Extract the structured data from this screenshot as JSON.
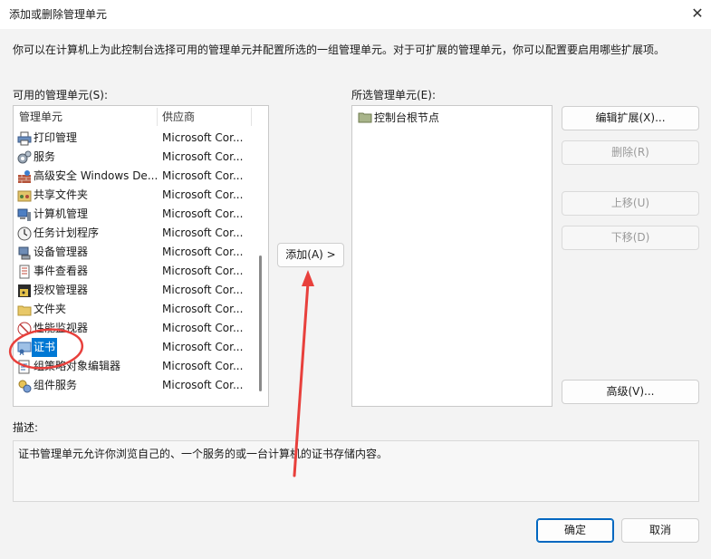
{
  "window": {
    "title": "添加或删除管理单元",
    "close_glyph": "✕"
  },
  "intro_text": "你可以在计算机上为此控制台选择可用的管理单元并配置所选的一组管理单元。对于可扩展的管理单元，你可以配置要启用哪些扩展项。",
  "available": {
    "label": "可用的管理单元(S):",
    "col_name": "管理单元",
    "col_vendor": "供应商",
    "items": [
      {
        "name": "打印管理",
        "vendor": "Microsoft Cor...",
        "icon": "printer-icon"
      },
      {
        "name": "服务",
        "vendor": "Microsoft Cor...",
        "icon": "gears-icon"
      },
      {
        "name": "高级安全 Windows De...",
        "vendor": "Microsoft Cor...",
        "icon": "firewall-icon"
      },
      {
        "name": "共享文件夹",
        "vendor": "Microsoft Cor...",
        "icon": "shared-folder-icon"
      },
      {
        "name": "计算机管理",
        "vendor": "Microsoft Cor...",
        "icon": "computer-management-icon"
      },
      {
        "name": "任务计划程序",
        "vendor": "Microsoft Cor...",
        "icon": "clock-icon"
      },
      {
        "name": "设备管理器",
        "vendor": "Microsoft Cor...",
        "icon": "device-manager-icon"
      },
      {
        "name": "事件查看器",
        "vendor": "Microsoft Cor...",
        "icon": "event-viewer-icon"
      },
      {
        "name": "授权管理器",
        "vendor": "Microsoft Cor...",
        "icon": "authorization-icon"
      },
      {
        "name": "文件夹",
        "vendor": "Microsoft Cor...",
        "icon": "folder-icon"
      },
      {
        "name": "性能监视器",
        "vendor": "Microsoft Cor...",
        "icon": "performance-icon"
      },
      {
        "name": "证书",
        "vendor": "Microsoft Cor...",
        "icon": "certificate-icon",
        "selected": true
      },
      {
        "name": "组策略对象编辑器",
        "vendor": "Microsoft Cor...",
        "icon": "group-policy-icon"
      },
      {
        "name": "组件服务",
        "vendor": "Microsoft Cor...",
        "icon": "component-services-icon"
      }
    ]
  },
  "add_button": "添加(A) >",
  "selected": {
    "label": "所选管理单元(E):",
    "items": [
      {
        "name": "控制台根节点",
        "icon": "folder-icon"
      }
    ]
  },
  "right_buttons": {
    "edit_extensions": "编辑扩展(X)...",
    "remove": "删除(R)",
    "move_up": "上移(U)",
    "move_down": "下移(D)",
    "advanced": "高级(V)..."
  },
  "description": {
    "label": "描述:",
    "text": "证书管理单元允许你浏览自己的、一个服务的或一台计算机的证书存储内容。"
  },
  "footer": {
    "ok": "确定",
    "cancel": "取消"
  },
  "annotation_color": "#e8403c"
}
